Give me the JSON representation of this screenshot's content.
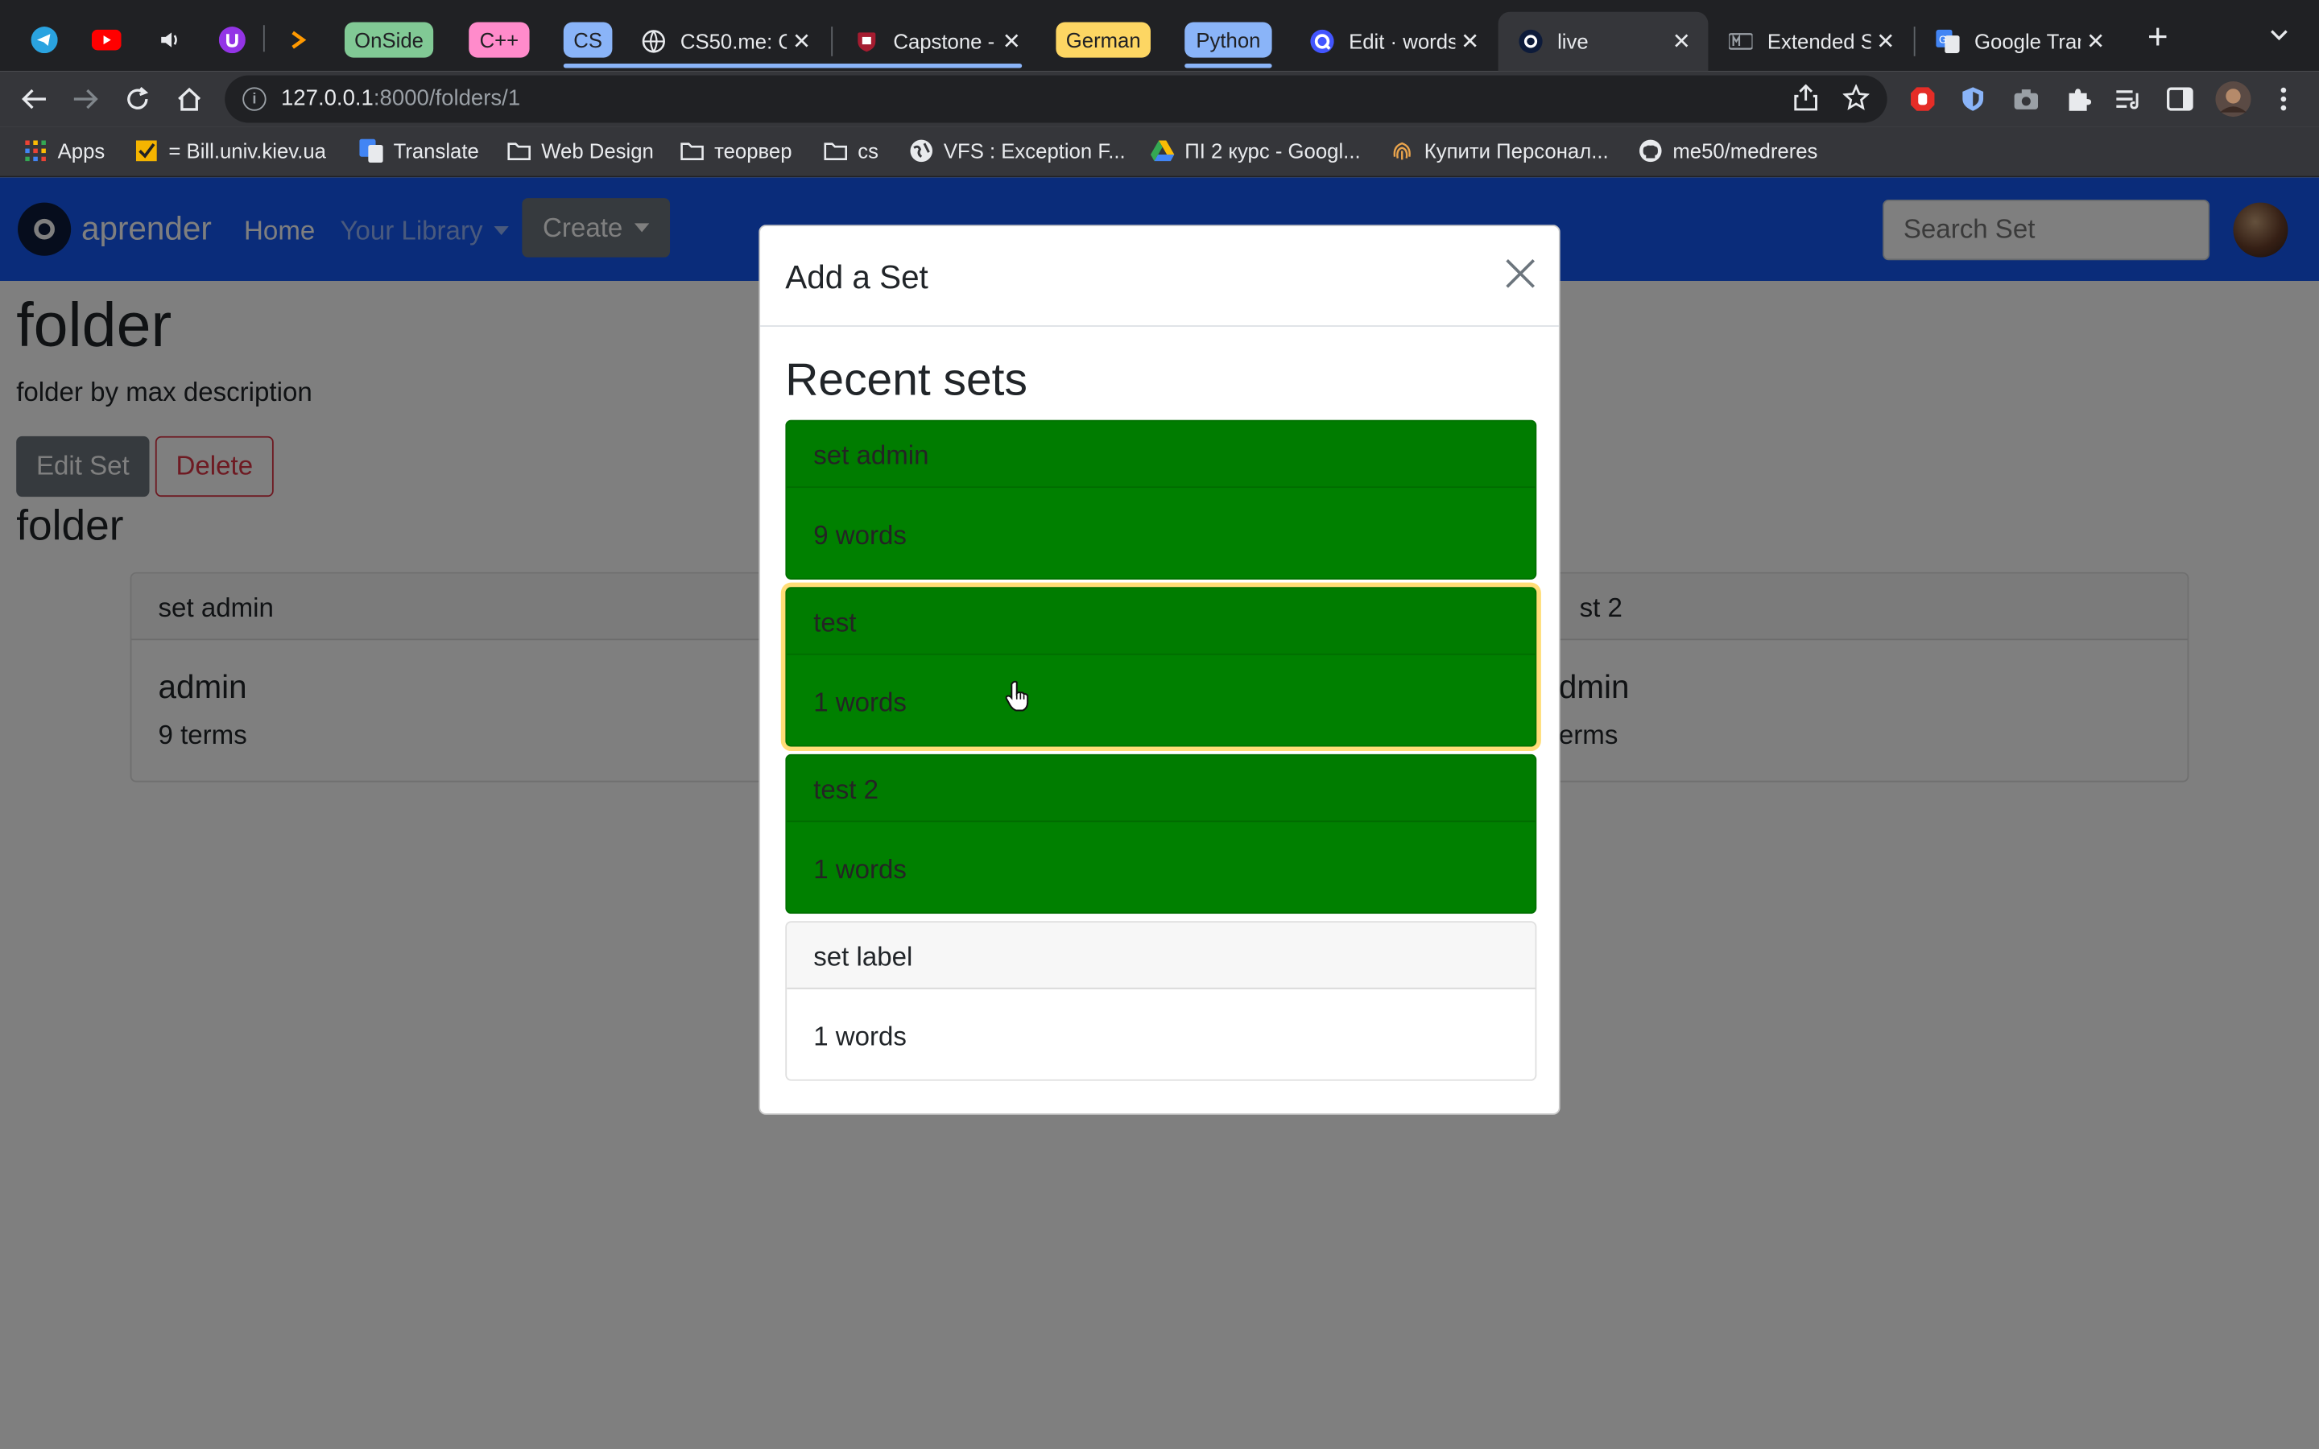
{
  "browser": {
    "tabs": {
      "groups": [
        {
          "label": "OnSide",
          "color": "#81c995"
        },
        {
          "label": "C++",
          "color": "#ff8bcb"
        },
        {
          "label": "CS",
          "color": "#8ab4f8"
        },
        {
          "label": "German",
          "color": "#fdd663"
        },
        {
          "label": "Python",
          "color": "#8ab4f8"
        }
      ],
      "items": [
        {
          "title": "CS50.me: C"
        },
        {
          "title": "Capstone - "
        },
        {
          "title": "Edit · words"
        },
        {
          "title": "live"
        },
        {
          "title": "Extended S"
        },
        {
          "title": "Google Tran"
        }
      ],
      "close_glyph": "✕",
      "new_tab_glyph": "+",
      "tab_list_glyph": "⌄"
    },
    "address": {
      "host": "127.0.0.1",
      "path": ":8000/folders/1",
      "info_glyph": "i"
    },
    "bookmarks": [
      {
        "label": "Apps",
        "icon": "apps-grid-icon"
      },
      {
        "label": "= Bill.univ.kiev.ua",
        "icon": "checkbox-icon"
      },
      {
        "label": "Translate",
        "icon": "google-translate-icon"
      },
      {
        "label": "Web Design",
        "icon": "folder-icon"
      },
      {
        "label": "теорвер",
        "icon": "folder-icon"
      },
      {
        "label": "cs",
        "icon": "folder-icon"
      },
      {
        "label": "VFS : Exception F...",
        "icon": "globe-icon"
      },
      {
        "label": "ПІ 2 курс - Googl...",
        "icon": "google-drive-icon"
      },
      {
        "label": "Купити Персонал...",
        "icon": "fingerprint-icon"
      },
      {
        "label": "me50/medreres",
        "icon": "github-icon"
      }
    ]
  },
  "app": {
    "brand": "aprender",
    "nav": {
      "home": "Home",
      "library": "Your Library",
      "create": "Create"
    },
    "search_placeholder": "Search Set"
  },
  "folder_page": {
    "title": "folder",
    "description": "folder by max description",
    "edit_label": "Edit Set",
    "delete_label": "Delete",
    "subtitle": "folder",
    "cards": [
      {
        "header": "set admin",
        "author": "admin",
        "terms": "9 terms"
      },
      {
        "header": "st 2",
        "author": "dmin",
        "terms": "erms"
      }
    ]
  },
  "modal": {
    "title": "Add a Set",
    "close_glyph": "✕",
    "section_title": "Recent sets",
    "sets": [
      {
        "name": "set admin",
        "count": "9 words",
        "selected": true
      },
      {
        "name": "test",
        "count": "1 words",
        "selected": true
      },
      {
        "name": "test 2",
        "count": "1 words",
        "selected": true
      },
      {
        "name": "set label",
        "count": "1 words",
        "selected": false
      }
    ]
  },
  "colors": {
    "app_nav": "#1459f4",
    "selected_set": "#008000",
    "delete": "#dc3545",
    "secondary": "#6c757d"
  }
}
